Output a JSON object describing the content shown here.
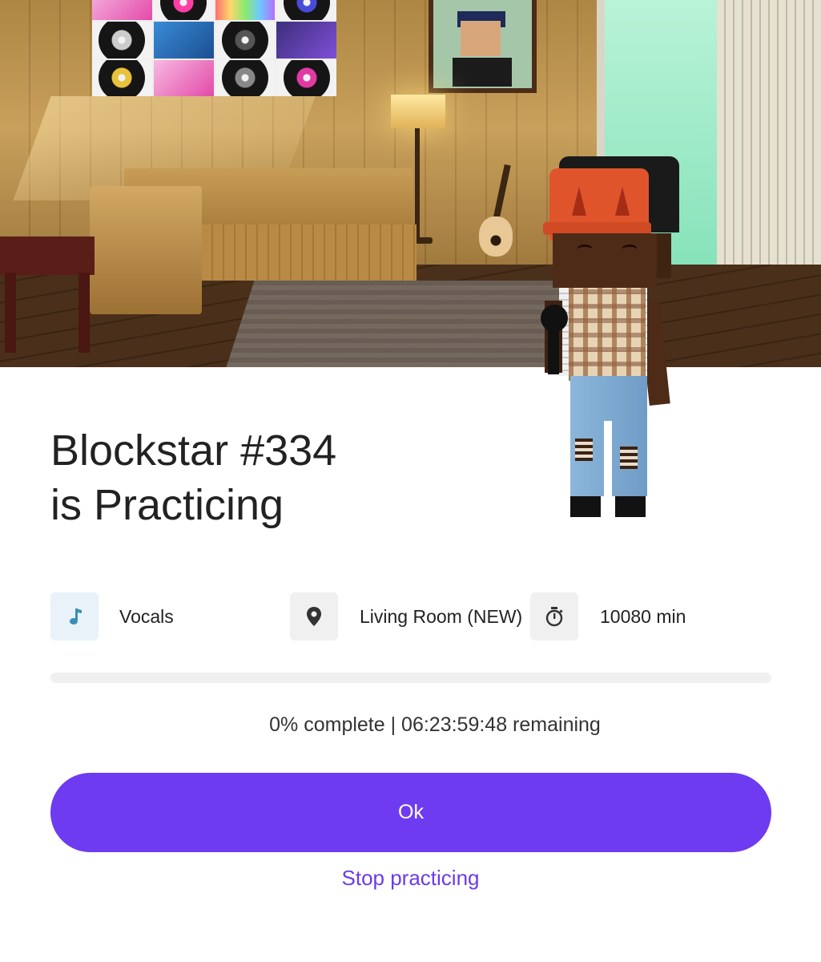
{
  "header": {
    "title_line1": "Blockstar #334",
    "title_line2": "is Practicing"
  },
  "details": {
    "skill": {
      "label": "Vocals",
      "icon": "music-note-icon",
      "icon_color": "#3a8fb7"
    },
    "location": {
      "label": "Living Room (NEW)",
      "icon": "map-pin-icon"
    },
    "duration": {
      "label": "10080 min",
      "icon": "stopwatch-icon"
    }
  },
  "progress": {
    "percent": 0,
    "status_text": "0% complete | 06:23:59:48 remaining"
  },
  "actions": {
    "ok_label": "Ok",
    "stop_label": "Stop practicing"
  },
  "scene": {
    "posters": [
      "",
      "",
      "",
      "",
      "",
      "",
      "",
      "",
      "",
      "",
      "",
      ""
    ]
  },
  "colors": {
    "primary": "#6f3bf0",
    "link": "#6a3ce8",
    "text": "#222222",
    "track": "#f0f0f0"
  }
}
